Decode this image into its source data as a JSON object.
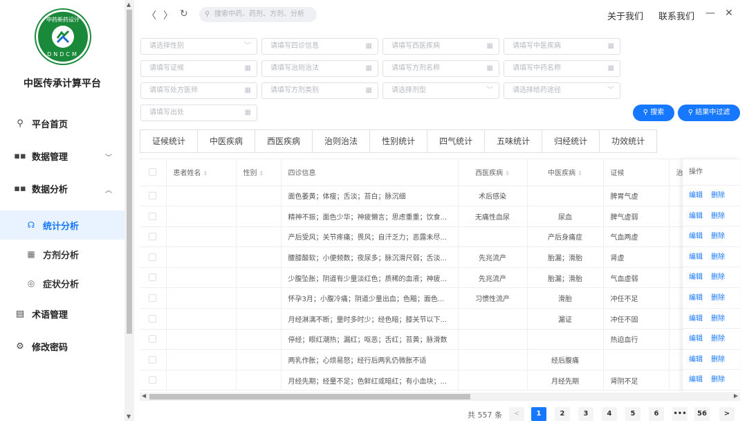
{
  "sidebar": {
    "logo": {
      "top_text": "中药新药设计",
      "bottom_text": "DNDCM",
      "color": "#1a8a3a"
    },
    "app_name": "中医传承计算平台",
    "items": [
      {
        "label": "平台首页",
        "icon": "location-pin-icon"
      },
      {
        "label": "数据管理",
        "icon": "grid-icon",
        "expanded": false
      },
      {
        "label": "数据分析",
        "icon": "grid-icon",
        "expanded": true
      },
      {
        "label": "统计分析",
        "icon": "headset-icon",
        "active": true
      },
      {
        "label": "方剂分析",
        "icon": "calendar-icon"
      },
      {
        "label": "症状分析",
        "icon": "eye-icon"
      },
      {
        "label": "术语管理",
        "icon": "document-icon"
      },
      {
        "label": "修改密码",
        "icon": "gear-icon"
      }
    ]
  },
  "topbar": {
    "search_placeholder": "搜索中药、药剂、方剂、分析",
    "about": "关于我们",
    "contact": "联系我们",
    "minimize": "—",
    "close": "✕"
  },
  "filters": {
    "row1": [
      "请选择性别",
      "请填写四诊信息",
      "请填写西医疾病",
      "请填写中医疾病"
    ],
    "row2": [
      "请填写证候",
      "请填写治则治法",
      "请填写方剂名称",
      "请填写中药名称"
    ],
    "row3": [
      "请填写处方医师",
      "请填写方剂类别",
      "请选择剂型",
      "请选择给药途径"
    ],
    "row4": [
      "请填写出处"
    ],
    "search_button": "搜索",
    "filter_button": "结果中过滤"
  },
  "tabs": [
    "证候统计",
    "中医疾病",
    "西医疾病",
    "治则治法",
    "性别统计",
    "四气统计",
    "五味统计",
    "归经统计",
    "功效统计"
  ],
  "table": {
    "headers": [
      "患者姓名",
      "性别",
      "四诊信息",
      "西医疾病",
      "中医疾病",
      "证候",
      "治"
    ],
    "ops_header": "操作",
    "edit": "编辑",
    "delete": "删除",
    "rows": [
      {
        "name": "",
        "gender": "",
        "info": "面色萎黄；体瘦；舌淡；苔白；脉沉细",
        "western": "术后感染",
        "tcm": "",
        "syndrome": "脾胃气虚"
      },
      {
        "name": "",
        "gender": "",
        "info": "精神不振；面色少华；神疲懒言；思虑重重；饮食...",
        "western": "无痛性血尿",
        "tcm": "尿血",
        "syndrome": "脾气虚弱"
      },
      {
        "name": "",
        "gender": "",
        "info": "产后受风；关节疼痛；畏风；自汗乏力；恶露未尽...",
        "western": "",
        "tcm": "产后身痛症",
        "syndrome": "气血两虚"
      },
      {
        "name": "",
        "gender": "",
        "info": "腰膝酸软；小便频数；夜尿多；脉沉滑尺弱；舌淡...",
        "western": "先兆流产",
        "tcm": "胎漏；滑胎",
        "syndrome": "肾虚"
      },
      {
        "name": "",
        "gender": "",
        "info": "少腹坠胀；阴道有少量淡红色；质稀的血液；神疲...",
        "western": "先兆流产",
        "tcm": "胎漏；滑胎",
        "syndrome": "气血虚弱"
      },
      {
        "name": "",
        "gender": "",
        "info": "怀孕3月；小腹冷痛；阴道少量出血；色黯；面色...",
        "western": "习惯性流产",
        "tcm": "滑胎",
        "syndrome": "冲任不足"
      },
      {
        "name": "",
        "gender": "",
        "info": "月经淋漓不断；量时多时少；经色暗；膝关节以下...",
        "western": "",
        "tcm": "漏证",
        "syndrome": "冲任不固"
      },
      {
        "name": "",
        "gender": "",
        "info": "停经；眼红潮热；漏红；呕恶；舌红；苔黄；脉滑数",
        "western": "",
        "tcm": "",
        "syndrome": "热迫血行"
      },
      {
        "name": "",
        "gender": "",
        "info": "两乳作胀；心烦易怒；经行后两乳仍微胀不适",
        "western": "",
        "tcm": "经后腹痛",
        "syndrome": ""
      },
      {
        "name": "",
        "gender": "",
        "info": "月经先期；经量不足；色鲜红或暗红；有小血块；...",
        "western": "",
        "tcm": "月经先期",
        "syndrome": "肾阴不足"
      }
    ]
  },
  "pagination": {
    "total": "共 557 条",
    "pages": [
      "1",
      "2",
      "3",
      "4",
      "5",
      "6",
      "•••",
      "56"
    ],
    "current": "1",
    "prev": "<",
    "next": ">"
  }
}
